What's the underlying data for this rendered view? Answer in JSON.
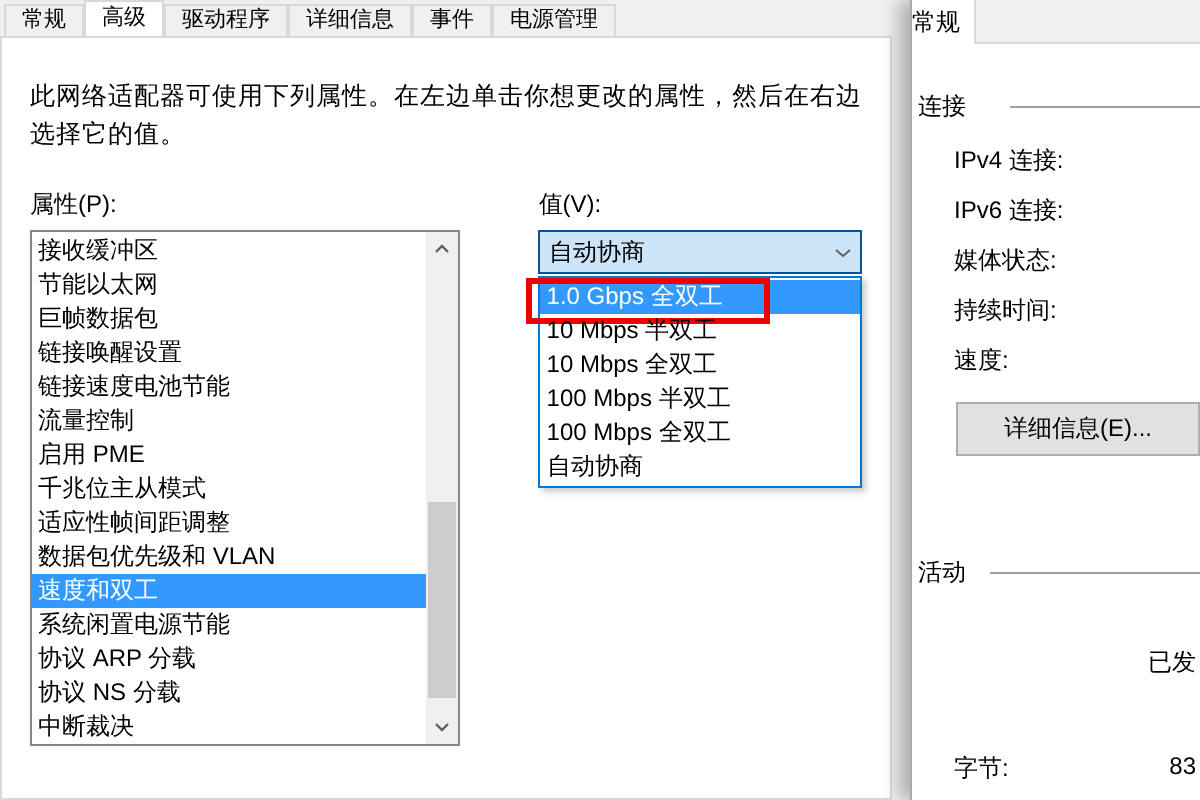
{
  "dialog": {
    "tabs": [
      {
        "label": "常规",
        "selected": false
      },
      {
        "label": "高级",
        "selected": true
      },
      {
        "label": "驱动程序",
        "selected": false
      },
      {
        "label": "详细信息",
        "selected": false
      },
      {
        "label": "事件",
        "selected": false
      },
      {
        "label": "电源管理",
        "selected": false
      }
    ],
    "description": "此网络适配器可使用下列属性。在左边单击你想更改的属性，然后在右边选择它的值。",
    "property_label": "属性(P):",
    "properties": [
      {
        "label": "接收缓冲区",
        "selected": false
      },
      {
        "label": "节能以太网",
        "selected": false
      },
      {
        "label": "巨帧数据包",
        "selected": false
      },
      {
        "label": "链接唤醒设置",
        "selected": false
      },
      {
        "label": "链接速度电池节能",
        "selected": false
      },
      {
        "label": "流量控制",
        "selected": false
      },
      {
        "label": "启用 PME",
        "selected": false
      },
      {
        "label": "千兆位主从模式",
        "selected": false
      },
      {
        "label": "适应性帧间距调整",
        "selected": false
      },
      {
        "label": "数据包优先级和 VLAN",
        "selected": false
      },
      {
        "label": "速度和双工",
        "selected": true
      },
      {
        "label": "系统闲置电源节能",
        "selected": false
      },
      {
        "label": "协议 ARP 分载",
        "selected": false
      },
      {
        "label": "协议 NS 分载",
        "selected": false
      },
      {
        "label": "中断裁决",
        "selected": false
      }
    ],
    "value_label": "值(V):",
    "value_select": {
      "value": "自动协商",
      "expanded": true
    },
    "value_options": [
      {
        "label": "1.0 Gbps 全双工",
        "selected": true,
        "annotated": true
      },
      {
        "label": "10 Mbps 半双工",
        "selected": false,
        "annotated": false
      },
      {
        "label": "10 Mbps 全双工",
        "selected": false,
        "annotated": false
      },
      {
        "label": "100 Mbps 半双工",
        "selected": false,
        "annotated": false
      },
      {
        "label": "100 Mbps 全双工",
        "selected": false,
        "annotated": false
      },
      {
        "label": "自动协商",
        "selected": false,
        "annotated": false
      }
    ]
  },
  "status_window": {
    "tab": "常规",
    "connection_heading": "连接",
    "fields": [
      {
        "label": "IPv4 连接:"
      },
      {
        "label": "IPv6 连接:"
      },
      {
        "label": "媒体状态:"
      },
      {
        "label": "持续时间:"
      },
      {
        "label": "速度:"
      }
    ],
    "details_button": "详细信息(E)...",
    "activity_heading": "活动",
    "sent_label": "已发",
    "bytes_label": "字节:",
    "bytes_value": "83"
  }
}
